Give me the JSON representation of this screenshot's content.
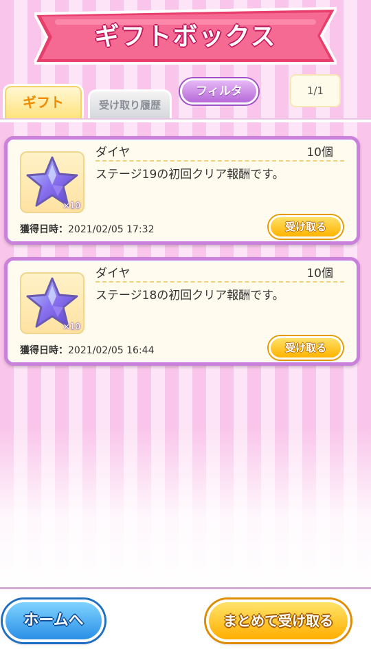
{
  "header": {
    "title": "ギフトボックス",
    "banner_color": "#f0527f"
  },
  "tabs": [
    {
      "label": "ギフト",
      "active": true
    },
    {
      "label": "受け取り履歴",
      "active": false
    }
  ],
  "filter_label": "フィルタ",
  "page_indicator": "1/1",
  "gifts": [
    {
      "name": "ダイヤ",
      "quantity": "10個",
      "description": "ステージ19の初回クリア報酬です。",
      "icon": "diamond-star-icon",
      "icon_count": "×10",
      "acquired_label": "獲得日時：",
      "acquired_at": "2021/02/05 17:32",
      "button_label": "受け取る"
    },
    {
      "name": "ダイヤ",
      "quantity": "10個",
      "description": "ステージ18の初回クリア報酬です。",
      "icon": "diamond-star-icon",
      "icon_count": "×10",
      "acquired_label": "獲得日時：",
      "acquired_at": "2021/02/05 16:44",
      "button_label": "受け取る"
    }
  ],
  "footer": {
    "home_label": "ホームへ",
    "bulk_receive_label": "まとめて受け取る"
  },
  "colors": {
    "stripe_pink": "#f9c5ea",
    "card_border": "#c981dc",
    "gold_button": "#ffb300",
    "blue_button": "#2b8fe6"
  }
}
